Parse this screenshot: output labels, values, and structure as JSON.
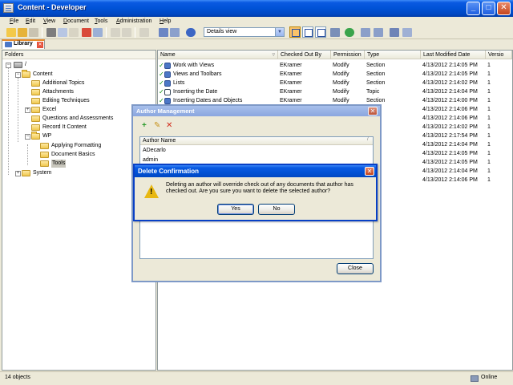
{
  "window": {
    "title": "Content - Developer"
  },
  "menu": [
    "File",
    "Edit",
    "View",
    "Document",
    "Tools",
    "Administration",
    "Help"
  ],
  "toolbar": {
    "view_select": "Details view"
  },
  "tab": {
    "label": "Library"
  },
  "folders": {
    "header": "Folders",
    "items": [
      {
        "label": "/"
      },
      {
        "label": "Content"
      },
      {
        "label": "Additional Topics"
      },
      {
        "label": "Attachments"
      },
      {
        "label": "Editing Techniques"
      },
      {
        "label": "Excel"
      },
      {
        "label": "Questions and Assessments"
      },
      {
        "label": "Record It Content"
      },
      {
        "label": "WP"
      },
      {
        "label": "Applying Formatting"
      },
      {
        "label": "Document Basics"
      },
      {
        "label": "Tools"
      },
      {
        "label": "System"
      }
    ]
  },
  "filelist": {
    "columns": [
      "Name",
      "Checked Out By",
      "Permission",
      "Type",
      "Last Modified Date",
      "Versio"
    ],
    "rows": [
      {
        "name": "Work with Views",
        "checked": "EKramer",
        "perm": "Modify",
        "type": "Section",
        "date": "4/13/2012 2:14:05 PM",
        "ver": "1"
      },
      {
        "name": "Views and Toolbars",
        "checked": "EKramer",
        "perm": "Modify",
        "type": "Section",
        "date": "4/13/2012 2:14:05 PM",
        "ver": "1"
      },
      {
        "name": "Lists",
        "checked": "EKramer",
        "perm": "Modify",
        "type": "Section",
        "date": "4/13/2012 2:14:02 PM",
        "ver": "1"
      },
      {
        "name": "Inserting the Date",
        "checked": "EKramer",
        "perm": "Modify",
        "type": "Topic",
        "date": "4/13/2012 2:14:04 PM",
        "ver": "1"
      },
      {
        "name": "Inserting Dates and Objects",
        "checked": "EKramer",
        "perm": "Modify",
        "type": "Section",
        "date": "4/13/2012 2:14:00 PM",
        "ver": "1"
      },
      {
        "name": "",
        "checked": "",
        "perm": "",
        "type": "",
        "date": "4/13/2012 2:14:06 PM",
        "ver": "1"
      },
      {
        "name": "",
        "checked": "",
        "perm": "",
        "type": "",
        "date": "4/13/2012 2:14:06 PM",
        "ver": "1"
      },
      {
        "name": "",
        "checked": "",
        "perm": "",
        "type": "",
        "date": "4/13/2012 2:14:02 PM",
        "ver": "1"
      },
      {
        "name": "",
        "checked": "",
        "perm": "",
        "type": "",
        "date": "4/13/2012 2:17:54 PM",
        "ver": "1"
      },
      {
        "name": "",
        "checked": "",
        "perm": "",
        "type": "",
        "date": "4/13/2012 2:14:04 PM",
        "ver": "1"
      },
      {
        "name": "",
        "checked": "",
        "perm": "",
        "type": "",
        "date": "4/13/2012 2:14:05 PM",
        "ver": "1"
      },
      {
        "name": "",
        "checked": "",
        "perm": "",
        "type": "",
        "date": "4/13/2012 2:14:05 PM",
        "ver": "1"
      },
      {
        "name": "",
        "checked": "",
        "perm": "",
        "type": "",
        "date": "4/13/2012 2:14:04 PM",
        "ver": "1"
      },
      {
        "name": "",
        "checked": "",
        "perm": "",
        "type": "",
        "date": "4/13/2012 2:14:06 PM",
        "ver": "1"
      }
    ]
  },
  "status": {
    "left": "14 objects",
    "right": "Online"
  },
  "author_dialog": {
    "title": "Author Management",
    "column": "Author Name",
    "authors": [
      "ADecarlo",
      "admin"
    ],
    "close_label": "Close"
  },
  "confirm_dialog": {
    "title": "Delete Confirmation",
    "message": "Deleting an author will override check out of any documents that author has checked out.  Are you sure you want to delete the selected author?",
    "yes_label": "Yes",
    "no_label": "No"
  },
  "colors": {
    "xp_blue": "#0052d6",
    "check_green": "#119111",
    "warning_yellow": "#e8b812"
  }
}
